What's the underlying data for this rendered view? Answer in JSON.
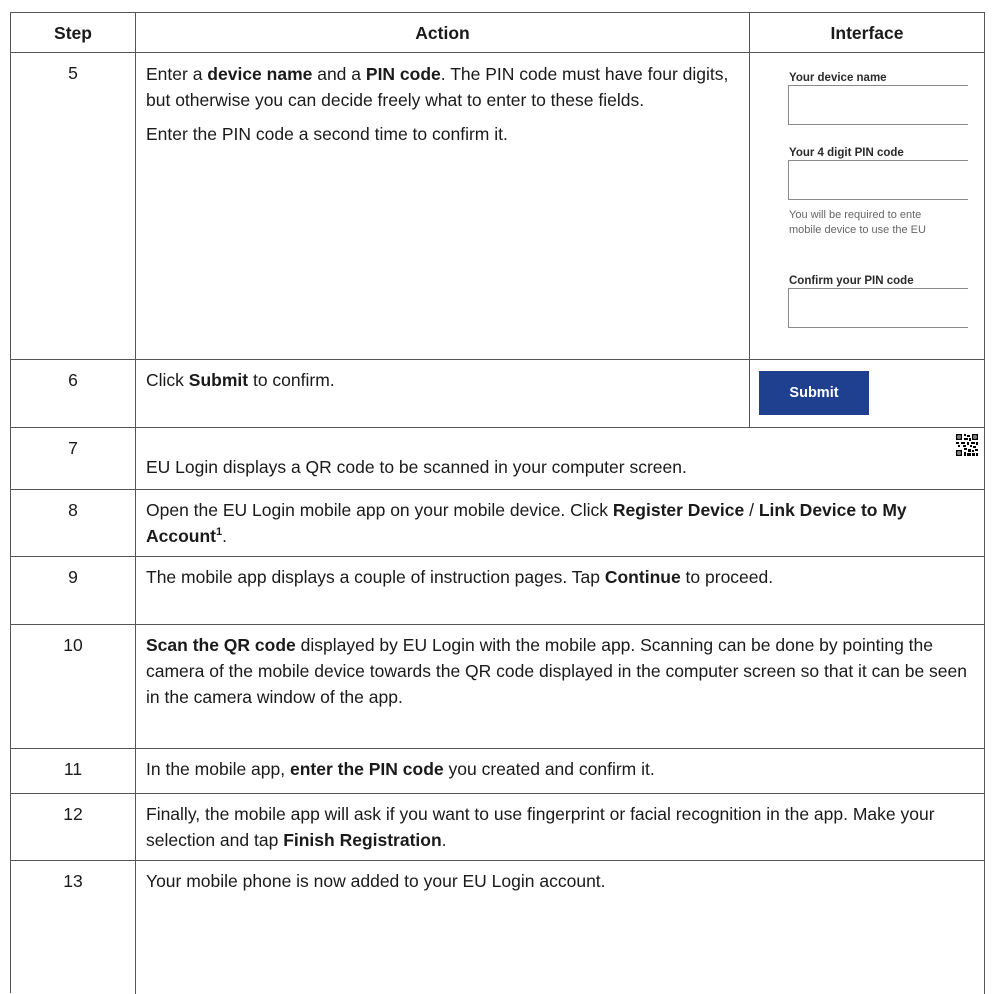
{
  "headers": {
    "step": "Step",
    "action": "Action",
    "interface": "Interface"
  },
  "rows": [
    {
      "step": "5",
      "action_p1": [
        "Enter a ",
        "device name",
        " and a ",
        "PIN code",
        ". The PIN code must have four digits, but otherwise you can decide freely what to enter to these fields."
      ],
      "action_p2": "Enter the PIN code a second time to confirm it."
    },
    {
      "step": "6",
      "action": [
        "Click ",
        "Submit",
        " to confirm."
      ]
    },
    {
      "step": "7",
      "action": "EU Login displays a QR code to be scanned in your computer screen."
    },
    {
      "step": "8",
      "action": [
        "Open the EU Login mobile app on your mobile device. Click ",
        "Register Device",
        " / ",
        "Link Device to My Account",
        "1",
        "."
      ]
    },
    {
      "step": "9",
      "action": [
        "The mobile app displays a couple of instruction pages. Tap ",
        "Continue",
        " to proceed."
      ]
    },
    {
      "step": "10",
      "action": [
        "Scan the QR code",
        " displayed by EU Login with the mobile app. Scanning can be done by pointing the camera of the mobile device towards the QR code displayed in the computer screen so that it can be seen in the camera window of the app."
      ]
    },
    {
      "step": "11",
      "action": [
        "In the mobile app, ",
        "enter the PIN code",
        " you created and confirm it."
      ]
    },
    {
      "step": "12",
      "action": [
        "Finally, the mobile app will ask if you want to use fingerprint or facial recognition in the app. Make your selection and tap ",
        "Finish Registration",
        "."
      ]
    },
    {
      "step": "13",
      "action": "Your mobile phone is now added to your EU Login account."
    }
  ],
  "interface": {
    "device_name_label": "Your device name",
    "pin_label": "Your 4 digit PIN code",
    "pin_help_1": "You will be required to ente",
    "pin_help_2": "mobile device to use the EU",
    "confirm_label": "Confirm your PIN code",
    "submit_label": "Submit",
    "qr_icon": "qr-code-icon"
  }
}
